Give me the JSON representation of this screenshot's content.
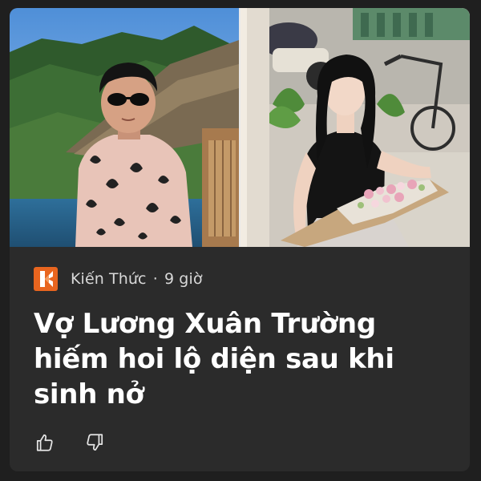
{
  "article": {
    "source_name": "Kiến Thức",
    "separator": "·",
    "time_ago": "9 giờ",
    "headline": "Vợ Lương Xuân Trường hiếm hoi lộ diện sau khi sinh nở"
  },
  "icons": {
    "source_logo": "kienthuc-logo-icon",
    "like": "thumbs-up-icon",
    "dislike": "thumbs-down-icon"
  },
  "colors": {
    "page_bg": "#1f1f1f",
    "card_bg": "#2b2b2b",
    "headline": "#ffffff",
    "meta_text": "#d8d8d8",
    "logo_orange": "#e8651f"
  }
}
